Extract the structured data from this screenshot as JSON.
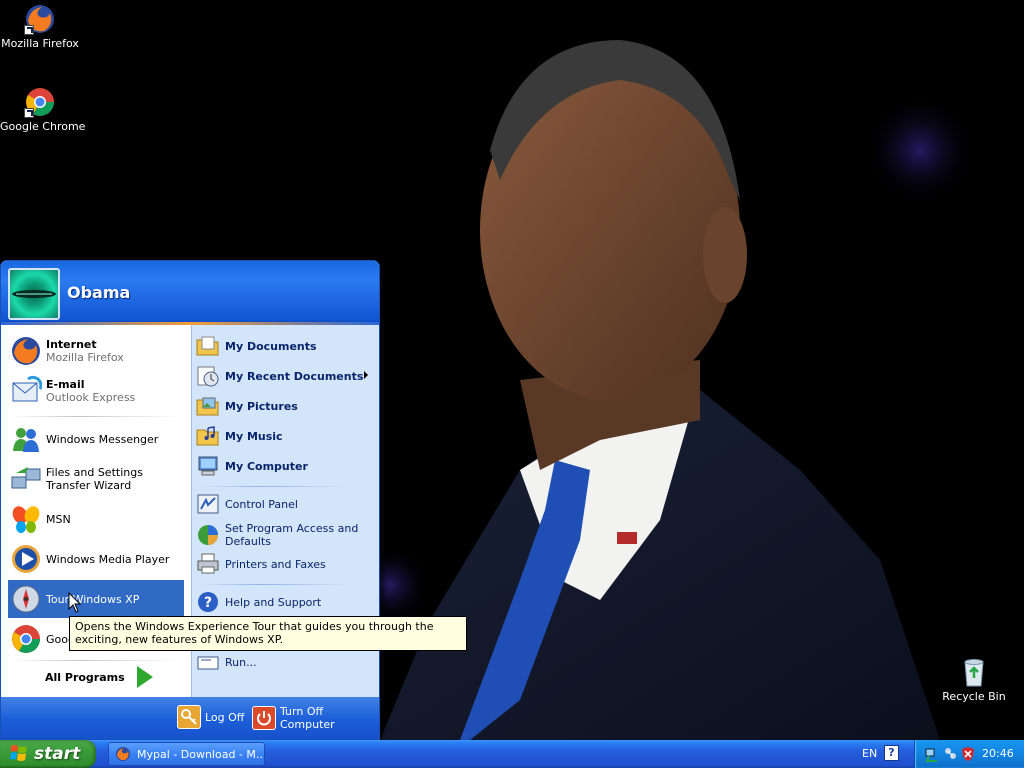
{
  "desktop": {
    "icons": [
      {
        "label": "Mozilla Firefox",
        "icon": "firefox-icon"
      },
      {
        "label": "Google Chrome",
        "icon": "chrome-icon"
      },
      {
        "label": "Recycle Bin",
        "icon": "recycle-bin-icon"
      }
    ]
  },
  "start_menu": {
    "user_name": "Obama",
    "pinned": [
      {
        "title": "Internet",
        "subtitle": "Mozilla Firefox",
        "icon": "firefox-icon"
      },
      {
        "title": "E-mail",
        "subtitle": "Outlook Express",
        "icon": "outlook-express-icon"
      }
    ],
    "recent": [
      {
        "label": "Windows Messenger",
        "icon": "messenger-icon"
      },
      {
        "label": "Files and Settings Transfer Wizard",
        "icon": "transfer-wizard-icon"
      },
      {
        "label": "MSN",
        "icon": "msn-butterfly-icon"
      },
      {
        "label": "Windows Media Player",
        "icon": "media-player-icon"
      },
      {
        "label": "Tour Windows XP",
        "icon": "tour-xp-icon",
        "highlighted": true
      },
      {
        "label": "Google Chrome",
        "icon": "chrome-icon"
      }
    ],
    "all_programs": "All Programs",
    "places": [
      {
        "label": "My Documents",
        "icon": "my-documents-icon"
      },
      {
        "label": "My Recent Documents",
        "icon": "recent-documents-icon",
        "submenu": true
      },
      {
        "label": "My Pictures",
        "icon": "my-pictures-icon"
      },
      {
        "label": "My Music",
        "icon": "my-music-icon"
      },
      {
        "label": "My Computer",
        "icon": "my-computer-icon"
      }
    ],
    "system": [
      {
        "label": "Control Panel",
        "icon": "control-panel-icon"
      },
      {
        "label": "Set Program Access and Defaults",
        "icon": "program-defaults-icon"
      },
      {
        "label": "Printers and Faxes",
        "icon": "printer-icon"
      }
    ],
    "help": [
      {
        "label": "Help and Support",
        "icon": "help-icon"
      },
      {
        "label": "Run...",
        "icon": "run-icon"
      }
    ],
    "footer": {
      "log_off": "Log Off",
      "turn_off": "Turn Off Computer"
    }
  },
  "tooltip": "Opens the Windows Experience Tour that guides you through the exciting, new features of Windows XP.",
  "taskbar": {
    "start_label": "start",
    "task": "Mypal - Download - M...",
    "language": "EN",
    "help": "?",
    "clock": "20:46"
  },
  "colors": {
    "taskbar_blue": "#245edb",
    "start_green": "#3c9d3a",
    "highlight": "#316ac5",
    "places_panel": "#d3e5fa"
  }
}
